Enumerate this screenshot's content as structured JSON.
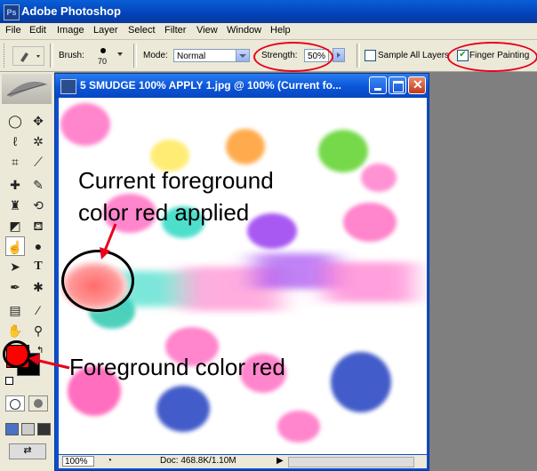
{
  "app": {
    "title": "Adobe Photoshop",
    "icon": "photoshop-icon"
  },
  "menubar": [
    "File",
    "Edit",
    "Image",
    "Layer",
    "Select",
    "Filter",
    "View",
    "Window",
    "Help"
  ],
  "options": {
    "brush_label": "Brush:",
    "brush_size": "70",
    "mode_label": "Mode:",
    "mode_value": "Normal",
    "strength_label": "Strength:",
    "strength_value": "50%",
    "sample_all_layers": {
      "label": "Sample All Layers",
      "checked": false
    },
    "finger_painting": {
      "label": "Finger Painting",
      "checked": true
    }
  },
  "document": {
    "title": "5 SMUDGE 100% APPLY 1.jpg @ 100% (Current fo...",
    "zoom": "100%",
    "doc_info": "Doc: 468.8K/1.10M"
  },
  "toolbox": {
    "foreground_color": "#ff0000",
    "background_color": "#000000"
  },
  "annotations": {
    "current_fg_line1": "Current foreground",
    "current_fg_line2": "color red applied",
    "fg_color_label": "Foreground color red"
  },
  "colors": {
    "highlight": "#e8001c",
    "title_blue": "#0a55d8",
    "chrome": "#ece9d8"
  }
}
